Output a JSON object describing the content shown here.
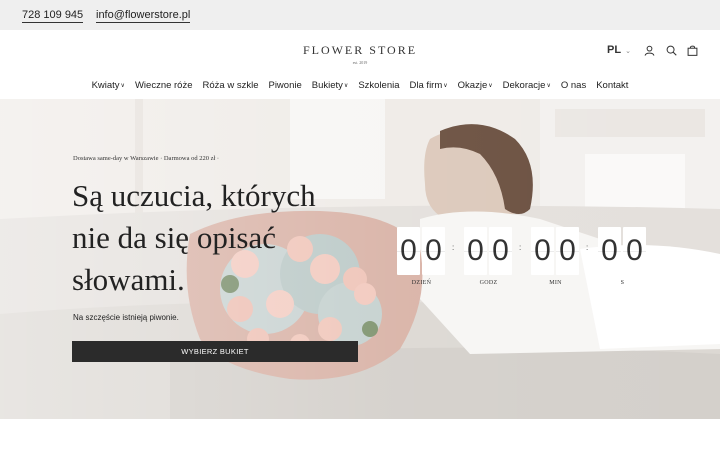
{
  "topbar": {
    "phone": "728 109 945",
    "email": "info@flowerstore.pl"
  },
  "header": {
    "logo": "FLOWER STORE",
    "logo_est": "est. 2019",
    "lang": "PL",
    "icons": [
      "user-icon",
      "search-icon",
      "bag-icon"
    ]
  },
  "nav": [
    {
      "label": "Kwiaty",
      "dropdown": true
    },
    {
      "label": "Wieczne róże",
      "dropdown": false
    },
    {
      "label": "Róża w szkle",
      "dropdown": false
    },
    {
      "label": "Piwonie",
      "dropdown": false
    },
    {
      "label": "Bukiety",
      "dropdown": true
    },
    {
      "label": "Szkolenia",
      "dropdown": false
    },
    {
      "label": "Dla firm",
      "dropdown": true
    },
    {
      "label": "Okazje",
      "dropdown": true
    },
    {
      "label": "Dekoracje",
      "dropdown": true
    },
    {
      "label": "O nas",
      "dropdown": false
    },
    {
      "label": "Kontakt",
      "dropdown": false
    }
  ],
  "hero": {
    "delivery": "Dostawa same-day w Warszawie · Darmowa od 220 zł ·",
    "headline_1": "Są uczucia, których",
    "headline_2": "nie da się opisać",
    "headline_3": "słowami.",
    "subline": "Na szczęście istnieją piwonie.",
    "cta": "WYBIERZ BUKIET"
  },
  "countdown": [
    {
      "digits": [
        "0",
        "0"
      ],
      "label": "DZIEŃ"
    },
    {
      "digits": [
        "0",
        "0"
      ],
      "label": "GODZ"
    },
    {
      "digits": [
        "0",
        "0"
      ],
      "label": "MIN"
    },
    {
      "digits": [
        "0",
        "0"
      ],
      "label": "S"
    }
  ],
  "colors": {
    "topbar": "#efefef",
    "cta": "#2b2b2b",
    "text": "#222222"
  }
}
